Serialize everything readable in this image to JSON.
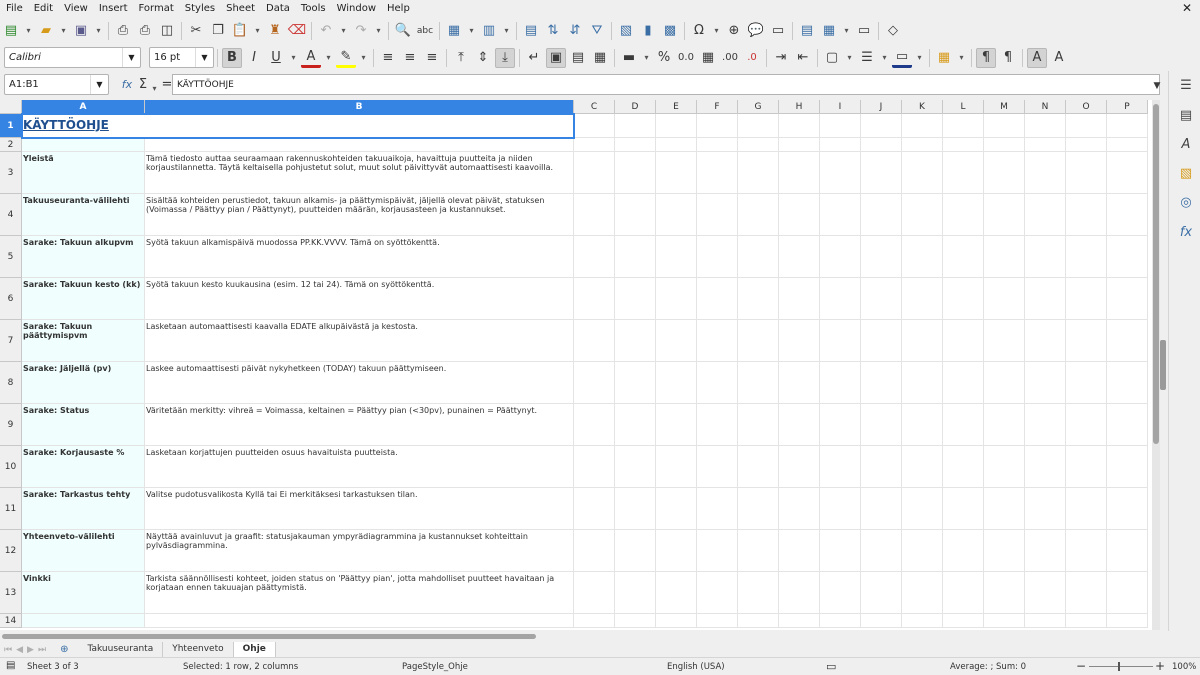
{
  "menu": [
    "File",
    "Edit",
    "View",
    "Insert",
    "Format",
    "Styles",
    "Sheet",
    "Data",
    "Tools",
    "Window",
    "Help"
  ],
  "font": {
    "name": "Calibri",
    "size": "16 pt"
  },
  "namebox": "A1:B1",
  "formula": "KÄYTTÖOHJE",
  "columns": [
    "A",
    "B",
    "C",
    "D",
    "E",
    "F",
    "G",
    "H",
    "I",
    "J",
    "K",
    "L",
    "M",
    "N",
    "O",
    "P"
  ],
  "rows": [
    {
      "n": "1",
      "a": "KÄYTTÖOHJE",
      "b": ""
    },
    {
      "n": "2",
      "a": "",
      "b": ""
    },
    {
      "n": "3",
      "a": "Yleistä",
      "b": "Tämä tiedosto auttaa seuraamaan rakennuskohteiden takuuaikoja, havaittuja puutteita ja niiden korjaustilannetta. Täytä keltaisella pohjustetut solut, muut solut päivittyvät automaattisesti kaavoilla."
    },
    {
      "n": "4",
      "a": "Takuuseuranta-välilehti",
      "b": "Sisältää kohteiden perustiedot, takuun alkamis- ja päättymispäivät, jäljellä olevat päivät, statuksen (Voimassa / Päättyy pian / Päättynyt), puutteiden määrän, korjausasteen ja kustannukset."
    },
    {
      "n": "5",
      "a": "Sarake: Takuun alkupvm",
      "b": "Syötä takuun alkamispäivä muodossa PP.KK.VVVV. Tämä on syöttökenttä."
    },
    {
      "n": "6",
      "a": "Sarake: Takuun kesto (kk)",
      "b": "Syötä takuun kesto kuukausina (esim. 12 tai 24). Tämä on syöttökenttä."
    },
    {
      "n": "7",
      "a": "Sarake: Takuun päättymispvm",
      "b": "Lasketaan automaattisesti kaavalla EDATE alkupäivästä ja kestosta."
    },
    {
      "n": "8",
      "a": "Sarake: Jäljellä (pv)",
      "b": "Laskee automaattisesti päivät nykyhetkeen (TODAY) takuun päättymiseen."
    },
    {
      "n": "9",
      "a": "Sarake: Status",
      "b": "Väritetään merkitty: vihreä = Voimassa, keltainen = Päättyy pian (<30pv), punainen = Päättynyt."
    },
    {
      "n": "10",
      "a": "Sarake: Korjausaste %",
      "b": "Lasketaan korjattujen puutteiden osuus havaituista puutteista."
    },
    {
      "n": "11",
      "a": "Sarake: Tarkastus tehty",
      "b": "Valitse pudotusvalikosta Kyllä tai Ei merkitäksesi tarkastuksen tilan."
    },
    {
      "n": "12",
      "a": "Yhteenveto-välilehti",
      "b": "Näyttää avainluvut ja graafit: statusjakauman ympyrädiagrammina ja kustannukset kohteittain pylväsdiagrammina."
    },
    {
      "n": "13",
      "a": "Vinkki",
      "b": "Tarkista säännöllisesti kohteet, joiden status on 'Päättyy pian', jotta mahdolliset puutteet havaitaan ja korjataan ennen takuuajan päättymistä."
    },
    {
      "n": "14",
      "a": "",
      "b": ""
    }
  ],
  "tabs": [
    "Takuuseuranta",
    "Yhteenveto",
    "Ohje"
  ],
  "active_tab": "Ohje",
  "status": {
    "sheet": "Sheet 3 of 3",
    "selection": "Selected: 1 row, 2 columns",
    "pagestyle": "PageStyle_Ohje",
    "language": "English (USA)",
    "sum": "Average: ; Sum: 0",
    "zoom": "100%"
  },
  "colors": {
    "accent": "#3584e4",
    "colA": "#f0fefe",
    "title": "#1f4f8f"
  }
}
